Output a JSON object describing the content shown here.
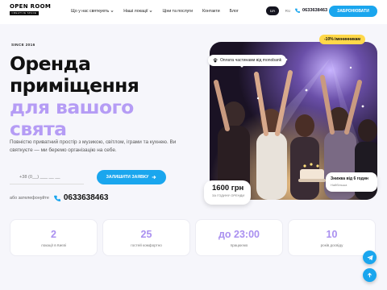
{
  "header": {
    "logo_main": "OPEN ROOM",
    "logo_sub": "CREATIVE SPACE",
    "nav": [
      {
        "label": "Що у нас святкують",
        "has_dropdown": true
      },
      {
        "label": "Наші локації",
        "has_dropdown": true
      },
      {
        "label": "Ціни та послуги",
        "has_dropdown": false
      },
      {
        "label": "Контакти",
        "has_dropdown": false
      },
      {
        "label": "Блог",
        "has_dropdown": false
      }
    ],
    "languages": [
      {
        "code": "UA",
        "active": true
      },
      {
        "code": "RU",
        "active": false
      }
    ],
    "phone": "0633638463",
    "cta": "ЗАБРОНЮВАТИ"
  },
  "hero": {
    "since": "SINCE 2016",
    "title_lines": [
      "Оренда",
      "приміщення"
    ],
    "title_accent_lines": [
      "для вашого",
      "свята"
    ],
    "description": "Повністю приватний простір з музикою, світлом, іграми та кухнею. Ви святкуєте — ми беремо організацію на себе.",
    "phone_placeholder": "+38 (0__) ___ __ __",
    "submit_label": "ЗАЛИШИТИ ЗАЯВКУ",
    "call_label": "або зателефонуйте",
    "call_phone": "0633638463"
  },
  "promo": {
    "discount_badge": "-10% іменинникам",
    "payment_badge": "Оплата частинами від monobank",
    "price_value": "1600 грн",
    "price_sub": "ЗА ГОДИНУ ОРЕНДИ",
    "card_title": "Знижка від 6 годин",
    "card_sub": "Найбільша"
  },
  "stats": [
    {
      "value": "2",
      "label": "локації в Києві"
    },
    {
      "value": "25",
      "label": "гостей комфортно"
    },
    {
      "value": "до 23:00",
      "label": "працюємо"
    },
    {
      "value": "10",
      "label": "років досвіду"
    }
  ],
  "colors": {
    "accent_blue": "#1aa6ee",
    "accent_purple": "#b59cf5",
    "badge_yellow": "#ffd84a"
  },
  "icons": {
    "phone": "phone-icon",
    "telegram": "telegram-icon",
    "scroll_up": "arrow-up-icon",
    "arrow": "arrow-right-icon",
    "dropdown": "chevron-down-icon"
  }
}
